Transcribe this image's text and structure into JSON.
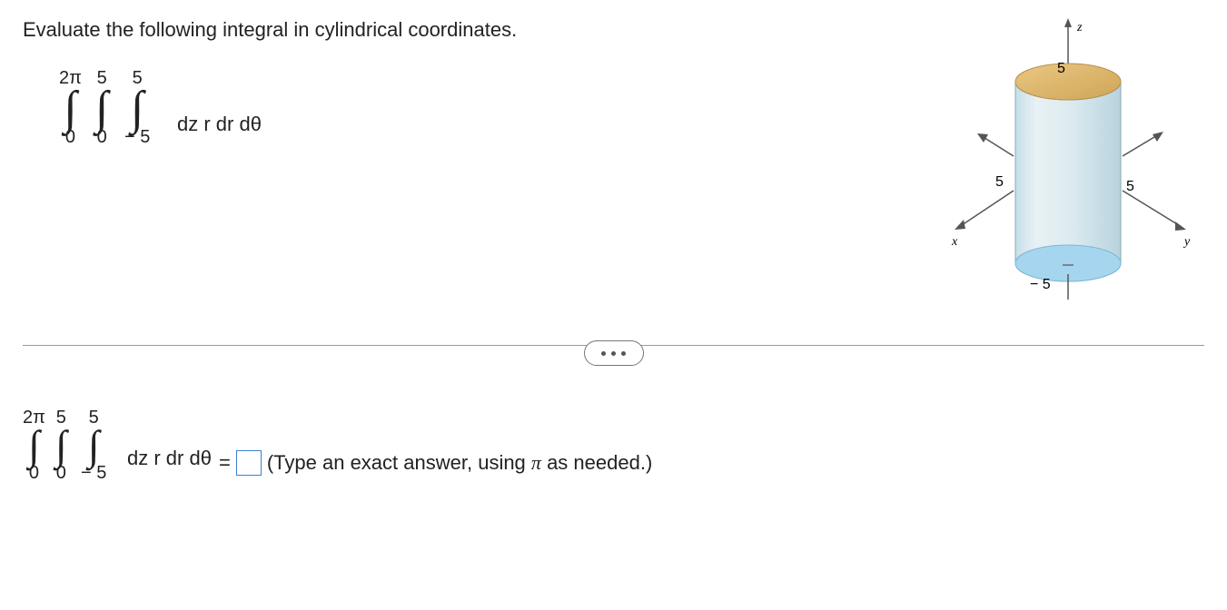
{
  "prompt": "Evaluate the following integral in cylindrical coordinates.",
  "integral": {
    "theta_upper": "2π",
    "theta_lower": "0",
    "r_upper": "5",
    "r_lower": "0",
    "z_upper": "5",
    "z_lower": "− 5",
    "integrand": "dz r dr dθ"
  },
  "answer_line": {
    "equals": "=",
    "hint_before": "(Type an exact answer, using ",
    "hint_pi": "π",
    "hint_after": " as needed.)"
  },
  "figure": {
    "axes": {
      "x": "x",
      "y": "y",
      "z": "z"
    },
    "labels": {
      "top": "5",
      "left": "5",
      "right": "5",
      "bottom": "− 5"
    }
  }
}
